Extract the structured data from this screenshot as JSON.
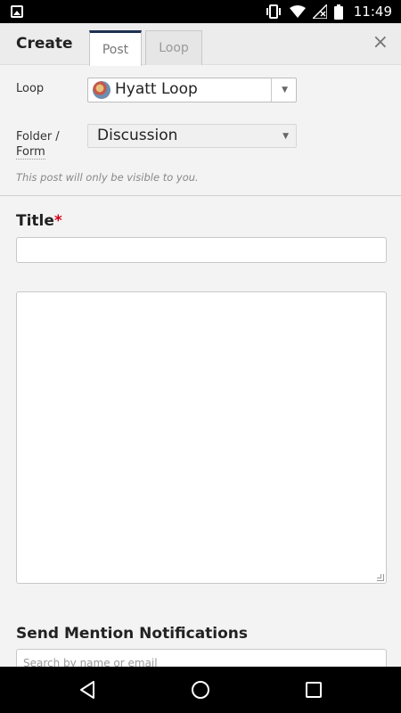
{
  "status_bar": {
    "time": "11:49"
  },
  "header": {
    "title": "Create",
    "tabs": [
      {
        "label": "Post",
        "active": true
      },
      {
        "label": "Loop",
        "active": false
      }
    ],
    "close_icon": "×"
  },
  "form": {
    "loop_label": "Loop",
    "loop_value": "Hyatt Loop",
    "folder_label_line1": "Folder /",
    "folder_label_line2": "Form",
    "folder_value": "Discussion",
    "visibility_notice": "This post will only be visible to you.",
    "title_label": "Title",
    "title_required_mark": "*",
    "title_value": "",
    "body_value": "",
    "mention_label": "Send Mention Notifications",
    "mention_placeholder": "Search by name or email"
  },
  "colors": {
    "active_tab_accent": "#1e3050",
    "required": "#d0021b"
  }
}
